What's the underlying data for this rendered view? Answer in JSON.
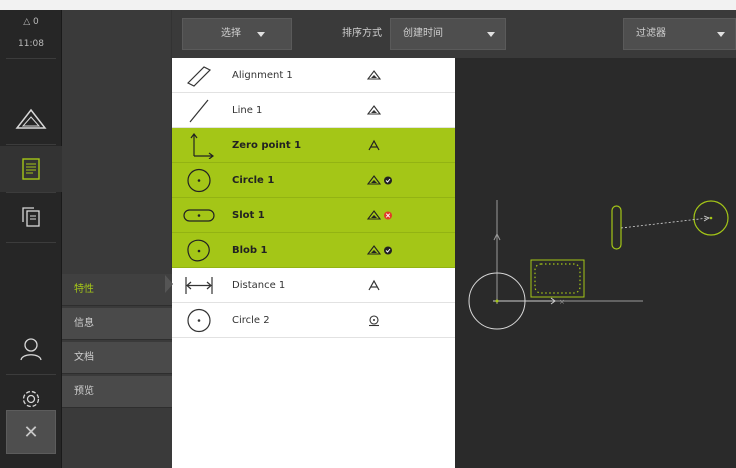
{
  "status": {
    "indicator": "△ 0",
    "time": "11:08"
  },
  "rail": {
    "icons": [
      "measure-icon",
      "document-icon",
      "copy-icon",
      "user-icon",
      "settings-icon",
      "power-icon"
    ]
  },
  "tabs": [
    {
      "label": "特性",
      "active": true
    },
    {
      "label": "信息",
      "active": false
    },
    {
      "label": "文档",
      "active": false
    },
    {
      "label": "预览",
      "active": false
    }
  ],
  "close_label": "✕",
  "toolbar": {
    "select_label": "选择",
    "sort_label": "排序方式",
    "sort_value": "创建时间",
    "filter_label": "过滤器"
  },
  "features": [
    {
      "name": "Alignment 1",
      "icon": "alignment-icon",
      "status": "measured",
      "highlighted": false
    },
    {
      "name": "Line 1",
      "icon": "line-icon",
      "status": "measured",
      "highlighted": false
    },
    {
      "name": "Zero point 1",
      "icon": "zero-point-icon",
      "status": "constructed",
      "highlighted": true
    },
    {
      "name": "Circle 1",
      "icon": "circle-icon",
      "status": "measured-ok",
      "highlighted": true
    },
    {
      "name": "Slot 1",
      "icon": "slot-icon",
      "status": "measured-fail",
      "highlighted": true
    },
    {
      "name": "Blob 1",
      "icon": "blob-icon",
      "status": "measured-ok",
      "highlighted": true
    },
    {
      "name": "Distance 1",
      "icon": "distance-icon",
      "status": "constructed",
      "highlighted": false
    },
    {
      "name": "Circle 2",
      "icon": "circle-icon",
      "status": "defined",
      "highlighted": false
    }
  ],
  "colors": {
    "accent": "#a4c617",
    "panel_dark": "#3a3a3a",
    "canvas_bg": "#2a2a2a",
    "ok": "#ffffff",
    "fail": "#e03b2a"
  }
}
